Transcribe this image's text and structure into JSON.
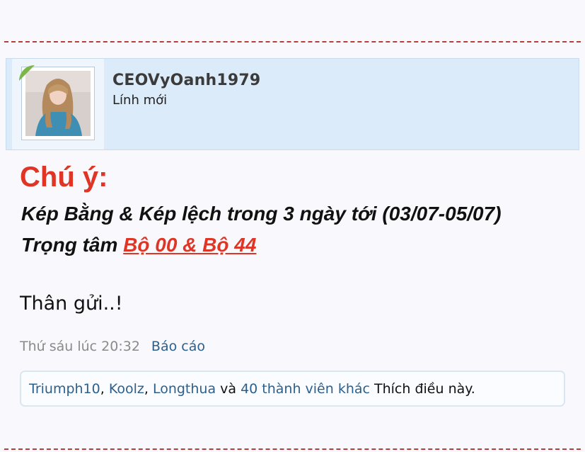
{
  "user": {
    "username": "CEOVyOanh1979",
    "title": "Lính mới"
  },
  "post": {
    "heading": "Chú ý:",
    "line1": "Kép Bằng & Kép lệch trong 3 ngày tới (03/07-05/07)",
    "line2_prefix": "Trọng tâm ",
    "line2_link": "Bộ 00 & Bộ 44 ",
    "closing": "Thân gửi..!"
  },
  "meta": {
    "timestamp": "Thứ sáu lúc 20:32",
    "report_label": "Báo cáo"
  },
  "likes": {
    "users": [
      "Triumph10",
      "Koolz",
      "Longthua"
    ],
    "sep1": ", ",
    "sep2": ", ",
    "conjunction": " và ",
    "others_link": "40 thành viên khác",
    "suffix": " Thích điều này."
  },
  "colors": {
    "accent_red": "#e03524",
    "link_blue": "#2d5f8b",
    "user_bar_bg": "#dcebf9",
    "online_green": "#7ab648"
  }
}
